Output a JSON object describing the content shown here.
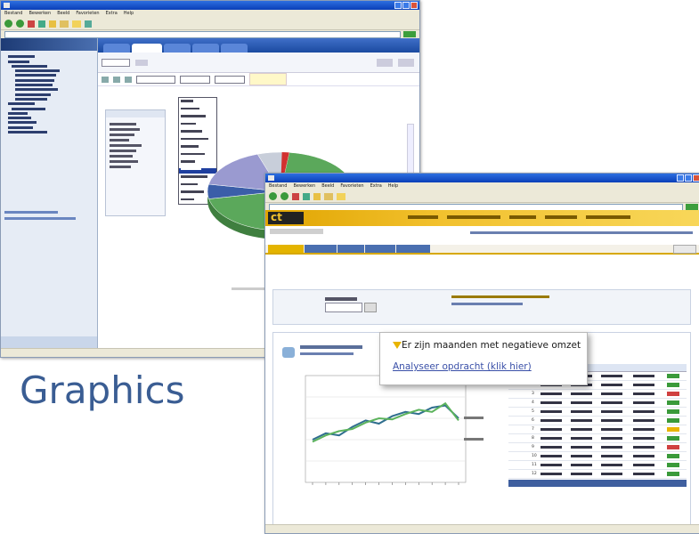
{
  "caption": "Graphics",
  "window1": {
    "title": "",
    "menu": [
      "Bestand",
      "Bewerken",
      "Beeld",
      "Favorieten",
      "Extra",
      "Help"
    ],
    "tabs": [
      "",
      "",
      "",
      "",
      ""
    ],
    "sidebar_items": [
      "",
      "",
      "",
      "",
      "",
      "",
      "",
      "",
      "",
      "",
      "",
      "",
      "",
      "",
      "",
      "",
      ""
    ],
    "dropdown_options": [
      "",
      "",
      "",
      "",
      "",
      "",
      "",
      "",
      "",
      "",
      "",
      "",
      "",
      ""
    ],
    "chart_title": "",
    "chart_data": {
      "type": "pie",
      "title": "",
      "slices": [
        {
          "label": "",
          "value": 70,
          "color": "#5ba85b"
        },
        {
          "label": "",
          "value": 6,
          "color": "#3b5ea8"
        },
        {
          "label": "",
          "value": 17,
          "color": "#9a9ad0"
        },
        {
          "label": "",
          "value": 7,
          "color": "#c8ceda"
        }
      ],
      "extra_colors": [
        "#d23030"
      ]
    }
  },
  "window2": {
    "title": "",
    "menu": [
      "Bestand",
      "Bewerken",
      "Beeld",
      "Favorieten",
      "Extra",
      "Help"
    ],
    "brand": "ct",
    "page_title": "",
    "nav_tabs": [
      "",
      "",
      "",
      "",
      ""
    ],
    "popup": {
      "headline": "Er zijn maanden met negatieve omzet",
      "link": "Analyseer opdracht (klik hier)"
    },
    "table_rows": [
      "1",
      "2",
      "3",
      "4",
      "5",
      "6",
      "7",
      "8",
      "9",
      "10",
      "11",
      "12"
    ],
    "chart_data": {
      "type": "line",
      "title": "",
      "xlabel": "",
      "ylabel": "",
      "x": [
        1,
        2,
        3,
        4,
        5,
        6,
        7,
        8,
        9,
        10,
        11,
        12
      ],
      "series": [
        {
          "name": "",
          "color": "#2f6e8e",
          "values": [
            40,
            46,
            44,
            52,
            58,
            55,
            62,
            66,
            64,
            70,
            72,
            60
          ]
        },
        {
          "name": "",
          "color": "#5cb35c",
          "values": [
            38,
            44,
            48,
            50,
            56,
            60,
            59,
            64,
            68,
            66,
            74,
            58
          ]
        }
      ],
      "ylim": [
        0,
        100
      ]
    }
  }
}
